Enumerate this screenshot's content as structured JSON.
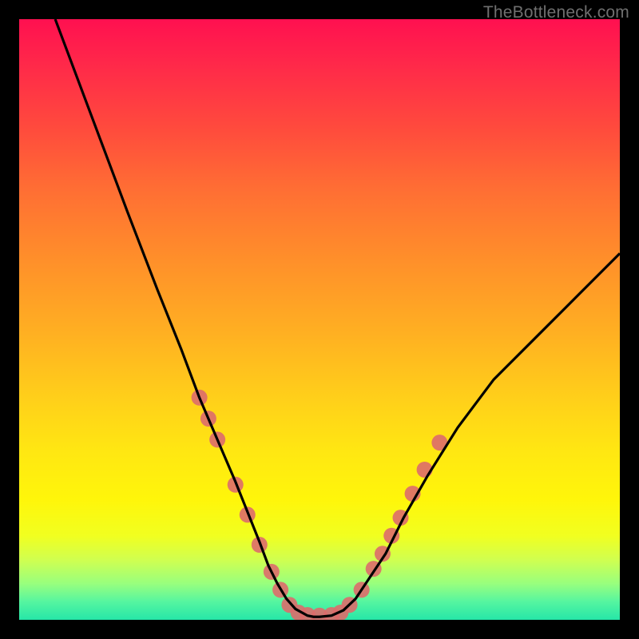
{
  "watermark": "TheBottleneck.com",
  "chart_data": {
    "type": "line",
    "title": "",
    "xlabel": "",
    "ylabel": "",
    "xlim": [
      0,
      100
    ],
    "ylim": [
      0,
      100
    ],
    "grid": false,
    "series": [
      {
        "name": "curve",
        "x": [
          6,
          12,
          18,
          23,
          27,
          30,
          33,
          36,
          38,
          40,
          41.5,
          43,
          44.5,
          46,
          48,
          49,
          50,
          52,
          54,
          56,
          58,
          61,
          64,
          68,
          73,
          79,
          86,
          93,
          100
        ],
        "y": [
          100,
          84,
          68,
          55,
          45,
          37,
          30,
          23,
          18,
          13,
          9,
          6,
          3.5,
          1.8,
          0.7,
          0.5,
          0.5,
          0.7,
          1.6,
          3.5,
          6.5,
          11,
          17,
          24,
          32,
          40,
          47,
          54,
          61
        ]
      }
    ],
    "markers": [
      {
        "x": 30.0,
        "y": 37.0
      },
      {
        "x": 31.5,
        "y": 33.5
      },
      {
        "x": 33.0,
        "y": 30.0
      },
      {
        "x": 36.0,
        "y": 22.5
      },
      {
        "x": 38.0,
        "y": 17.5
      },
      {
        "x": 40.0,
        "y": 12.5
      },
      {
        "x": 42.0,
        "y": 8.0
      },
      {
        "x": 43.5,
        "y": 5.0
      },
      {
        "x": 45.0,
        "y": 2.5
      },
      {
        "x": 46.5,
        "y": 1.2
      },
      {
        "x": 48.0,
        "y": 0.8
      },
      {
        "x": 50.0,
        "y": 0.7
      },
      {
        "x": 52.0,
        "y": 0.8
      },
      {
        "x": 53.5,
        "y": 1.2
      },
      {
        "x": 55.0,
        "y": 2.5
      },
      {
        "x": 57.0,
        "y": 5.0
      },
      {
        "x": 59.0,
        "y": 8.5
      },
      {
        "x": 60.5,
        "y": 11.0
      },
      {
        "x": 62.0,
        "y": 14.0
      },
      {
        "x": 63.5,
        "y": 17.0
      },
      {
        "x": 65.5,
        "y": 21.0
      },
      {
        "x": 67.5,
        "y": 25.0
      },
      {
        "x": 70.0,
        "y": 29.5
      }
    ],
    "colors": {
      "curve": "#000000",
      "markers": "#dd6b6b"
    }
  }
}
